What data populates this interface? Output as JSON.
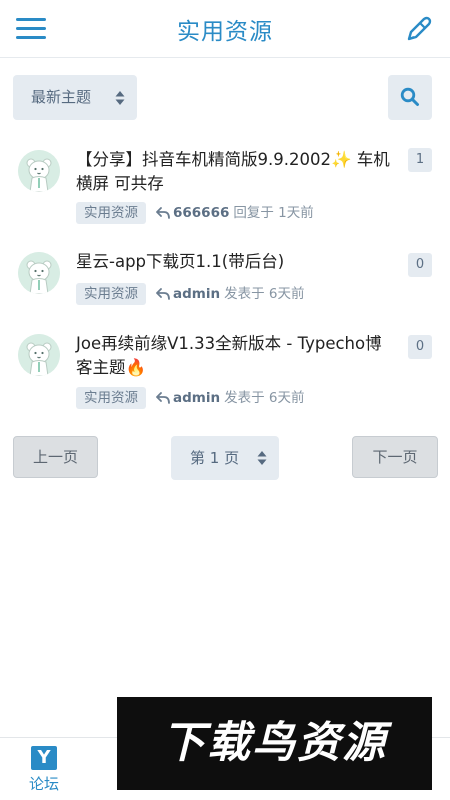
{
  "header": {
    "title": "实用资源",
    "menu_icon": "hamburger-menu-icon",
    "compose_icon": "pen-icon"
  },
  "toolbar": {
    "sort_label": "最新主题",
    "search_icon": "search-icon"
  },
  "topics": [
    {
      "title": "【分享】抖音车机精简版9.9.2002",
      "title_rest": "车机横屏 可共存",
      "title_emoji": "✨",
      "tag": "实用资源",
      "user": "666666",
      "action": "回复于 1天前",
      "replies": "1"
    },
    {
      "title": "星云-app下载页1.1(带后台)",
      "tag": "实用资源",
      "user": "admin",
      "action": "发表于 6天前",
      "replies": "0"
    },
    {
      "title": "Joe再续前缘V1.33全新版本 - Typecho博客主题",
      "title_emoji": "🔥",
      "tag": "实用资源",
      "user": "admin",
      "action": "发表于 6天前",
      "replies": "0"
    }
  ],
  "pager": {
    "prev": "上一页",
    "page": "第 1 页",
    "next": "下一页"
  },
  "tabbar": {
    "forum_logo": "Y",
    "forum_label": "论坛"
  },
  "watermark": "下载鸟资源",
  "colors": {
    "accent": "#2a8bc6",
    "chip_bg": "#e5ebf1",
    "muted_text": "#8795a3"
  }
}
